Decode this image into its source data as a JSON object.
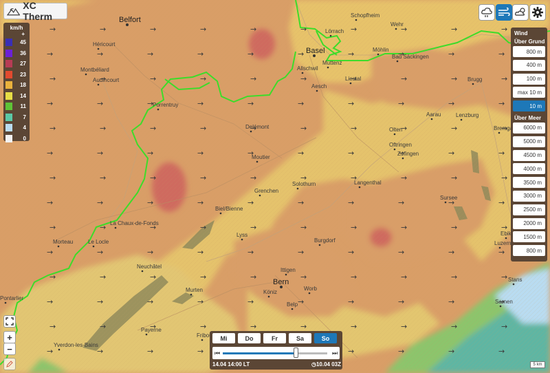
{
  "app": {
    "title": "XC Therm"
  },
  "legend": {
    "unit": "km/h",
    "plus": "+",
    "items": [
      {
        "label": "45",
        "color": "#3a2fb5"
      },
      {
        "label": "36",
        "color": "#6b21d6"
      },
      {
        "label": "27",
        "color": "#b73c55"
      },
      {
        "label": "23",
        "color": "#e34a2f"
      },
      {
        "label": "18",
        "color": "#eab13c"
      },
      {
        "label": "14",
        "color": "#e6dd45"
      },
      {
        "label": "11",
        "color": "#5fc337"
      },
      {
        "label": "7",
        "color": "#5bc8a6"
      },
      {
        "label": "4",
        "color": "#b9dcf1"
      },
      {
        "label": "0",
        "color": "#f2f2f2"
      }
    ]
  },
  "toolbar": {
    "icons": [
      "cloud-thermal-icon",
      "wind-icon",
      "weather-station-icon",
      "gear-icon"
    ]
  },
  "panel": {
    "wind_header": "Wind",
    "ground_header": "Über Grund",
    "ground_levels": [
      "800 m",
      "400 m",
      "100 m",
      "max 10 m",
      "10 m"
    ],
    "active_level": "10 m",
    "sea_header": "Über Meer",
    "sea_levels": [
      "6000 m",
      "5000 m",
      "4500 m",
      "4000 m",
      "3500 m",
      "3000 m",
      "2500 m",
      "2000 m",
      "1500 m",
      "800 m"
    ]
  },
  "map": {
    "places": [
      {
        "name": "Belfort",
        "big": true
      },
      {
        "name": "Héricourt"
      },
      {
        "name": "Montbéliard"
      },
      {
        "name": "Audincourt"
      },
      {
        "name": "Porrentruy"
      },
      {
        "name": "Delémont"
      },
      {
        "name": "Moutier"
      },
      {
        "name": "Basel",
        "big": true
      },
      {
        "name": "Lörrach"
      },
      {
        "name": "Schopfheim"
      },
      {
        "name": "Wehr"
      },
      {
        "name": "Allschwil"
      },
      {
        "name": "Muttenz"
      },
      {
        "name": "Möhlin"
      },
      {
        "name": "Bad Säckingen"
      },
      {
        "name": "Aesch"
      },
      {
        "name": "Liestal"
      },
      {
        "name": "Brugg"
      },
      {
        "name": "Aarau"
      },
      {
        "name": "Lenzburg"
      },
      {
        "name": "Olten"
      },
      {
        "name": "Oftringen"
      },
      {
        "name": "Zofingen"
      },
      {
        "name": "Bremgarten"
      },
      {
        "name": "Solothurn"
      },
      {
        "name": "Langenthal"
      },
      {
        "name": "Grenchen"
      },
      {
        "name": "Biel/Bienne"
      },
      {
        "name": "La Chaux-de-Fonds"
      },
      {
        "name": "Le Locle"
      },
      {
        "name": "Morteau"
      },
      {
        "name": "Lyss"
      },
      {
        "name": "Burgdorf"
      },
      {
        "name": "Sursee"
      },
      {
        "name": "Neuchâtel"
      },
      {
        "name": "Ittigen"
      },
      {
        "name": "Bern",
        "big": true
      },
      {
        "name": "Worb"
      },
      {
        "name": "Köniz"
      },
      {
        "name": "Belp"
      },
      {
        "name": "Murten"
      },
      {
        "name": "Payerne"
      },
      {
        "name": "Yverdon-les-Bains"
      },
      {
        "name": "Fribourg"
      },
      {
        "name": "Stans"
      },
      {
        "name": "Sarnen"
      },
      {
        "name": "Ebikon"
      },
      {
        "name": "Luzern"
      },
      {
        "name": "Pontarlier"
      }
    ],
    "scale_label": "5 km"
  },
  "time": {
    "days": [
      "Mi",
      "Do",
      "Fr",
      "Sa",
      "So"
    ],
    "active_day": "So",
    "position": 0.7,
    "current": "14.04 14:00 LT",
    "updated": "10.04 03Z"
  }
}
